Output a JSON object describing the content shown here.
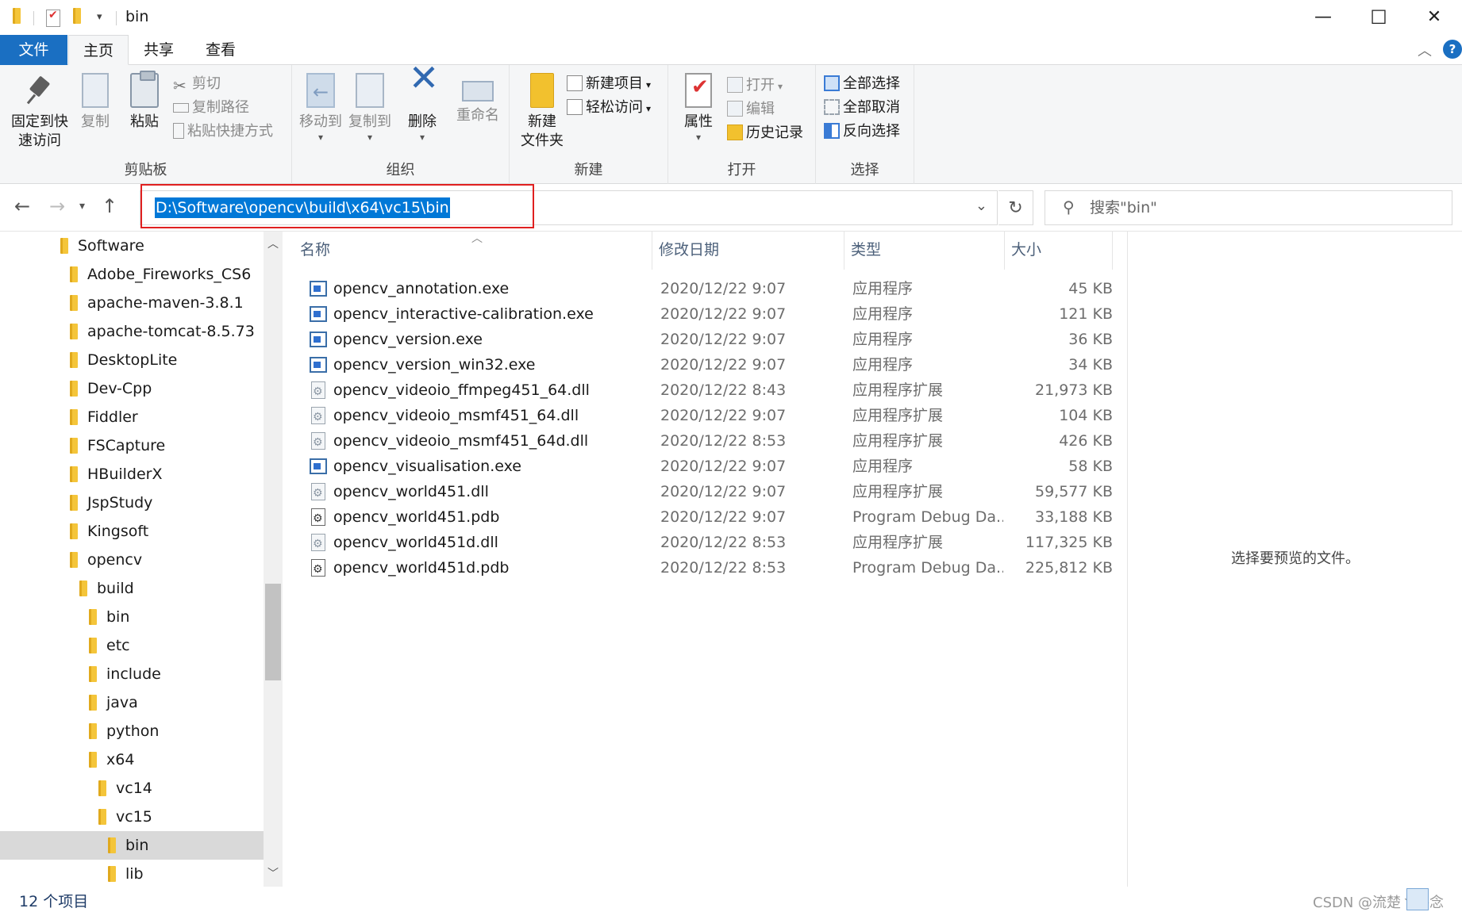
{
  "window": {
    "title": "bin",
    "minimize_glyph": "—",
    "maximize_glyph": "☐",
    "close_glyph": "✕"
  },
  "ribbon_tabs": {
    "file": "文件",
    "home": "主页",
    "share": "共享",
    "view": "查看"
  },
  "ribbon": {
    "clipboard": {
      "label": "剪贴板",
      "pin_line1": "固定到快",
      "pin_line2": "速访问",
      "copy": "复制",
      "paste": "粘贴",
      "cut": "剪切",
      "copy_path": "复制路径",
      "paste_shortcut": "粘贴快捷方式"
    },
    "organize": {
      "label": "组织",
      "move_to": "移动到",
      "copy_to": "复制到",
      "delete": "删除",
      "rename": "重命名"
    },
    "new": {
      "label": "新建",
      "new_folder_line1": "新建",
      "new_folder_line2": "文件夹",
      "new_item": "新建项目",
      "easy_access": "轻松访问"
    },
    "open": {
      "label": "打开",
      "properties": "属性",
      "open": "打开",
      "edit": "编辑",
      "history": "历史记录"
    },
    "select": {
      "label": "选择",
      "select_all": "全部选择",
      "select_none": "全部取消",
      "invert": "反向选择"
    }
  },
  "address": {
    "path": "D:\\Software\\opencv\\build\\x64\\vc15\\bin",
    "search_placeholder": "搜索\"bin\""
  },
  "tree": [
    {
      "label": "Software",
      "level": 0
    },
    {
      "label": "Adobe_Fireworks_CS6",
      "level": 1
    },
    {
      "label": "apache-maven-3.8.1",
      "level": 1
    },
    {
      "label": "apache-tomcat-8.5.73",
      "level": 1
    },
    {
      "label": "DesktopLite",
      "level": 1
    },
    {
      "label": "Dev-Cpp",
      "level": 1
    },
    {
      "label": "Fiddler",
      "level": 1
    },
    {
      "label": "FSCapture",
      "level": 1
    },
    {
      "label": "HBuilderX",
      "level": 1
    },
    {
      "label": "JspStudy",
      "level": 1
    },
    {
      "label": "Kingsoft",
      "level": 1
    },
    {
      "label": "opencv",
      "level": 1
    },
    {
      "label": "build",
      "level": 2
    },
    {
      "label": "bin",
      "level": 3
    },
    {
      "label": "etc",
      "level": 3
    },
    {
      "label": "include",
      "level": 3
    },
    {
      "label": "java",
      "level": 3
    },
    {
      "label": "python",
      "level": 3
    },
    {
      "label": "x64",
      "level": 3
    },
    {
      "label": "vc14",
      "level": 4
    },
    {
      "label": "vc15",
      "level": 4
    },
    {
      "label": "bin",
      "level": 5,
      "selected": true
    },
    {
      "label": "lib",
      "level": 5
    }
  ],
  "columns": {
    "name": "名称",
    "date": "修改日期",
    "type": "类型",
    "size": "大小"
  },
  "files": [
    {
      "name": "opencv_annotation.exe",
      "date": "2020/12/22 9:07",
      "type": "应用程序",
      "size": "45 KB",
      "icon": "exe"
    },
    {
      "name": "opencv_interactive-calibration.exe",
      "date": "2020/12/22 9:07",
      "type": "应用程序",
      "size": "121 KB",
      "icon": "exe"
    },
    {
      "name": "opencv_version.exe",
      "date": "2020/12/22 9:07",
      "type": "应用程序",
      "size": "36 KB",
      "icon": "exe"
    },
    {
      "name": "opencv_version_win32.exe",
      "date": "2020/12/22 9:07",
      "type": "应用程序",
      "size": "34 KB",
      "icon": "exe"
    },
    {
      "name": "opencv_videoio_ffmpeg451_64.dll",
      "date": "2020/12/22 8:43",
      "type": "应用程序扩展",
      "size": "21,973 KB",
      "icon": "dll"
    },
    {
      "name": "opencv_videoio_msmf451_64.dll",
      "date": "2020/12/22 9:07",
      "type": "应用程序扩展",
      "size": "104 KB",
      "icon": "dll"
    },
    {
      "name": "opencv_videoio_msmf451_64d.dll",
      "date": "2020/12/22 8:53",
      "type": "应用程序扩展",
      "size": "426 KB",
      "icon": "dll"
    },
    {
      "name": "opencv_visualisation.exe",
      "date": "2020/12/22 9:07",
      "type": "应用程序",
      "size": "58 KB",
      "icon": "exe"
    },
    {
      "name": "opencv_world451.dll",
      "date": "2020/12/22 9:07",
      "type": "应用程序扩展",
      "size": "59,577 KB",
      "icon": "dll"
    },
    {
      "name": "opencv_world451.pdb",
      "date": "2020/12/22 9:07",
      "type": "Program Debug Da...",
      "size": "33,188 KB",
      "icon": "pdb"
    },
    {
      "name": "opencv_world451d.dll",
      "date": "2020/12/22 8:53",
      "type": "应用程序扩展",
      "size": "117,325 KB",
      "icon": "dll"
    },
    {
      "name": "opencv_world451d.pdb",
      "date": "2020/12/22 8:53",
      "type": "Program Debug Da...",
      "size": "225,812 KB",
      "icon": "pdb"
    }
  ],
  "preview": {
    "empty_text": "选择要预览的文件。"
  },
  "status": {
    "item_count": "12 个项目",
    "watermark": "CSDN @流楚丶格念"
  },
  "colors": {
    "accent": "#1a6fc2",
    "selection": "#0078d7",
    "highlight_box": "#e02020",
    "folder": "#f2c12e"
  }
}
